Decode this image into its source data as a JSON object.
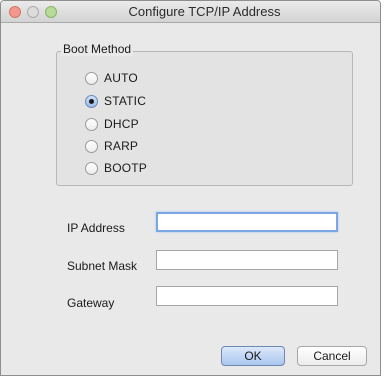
{
  "window": {
    "title": "Configure TCP/IP Address"
  },
  "boot_method": {
    "label": "Boot Method",
    "options": [
      {
        "label": "AUTO",
        "selected": false
      },
      {
        "label": "STATIC",
        "selected": true
      },
      {
        "label": "DHCP",
        "selected": false
      },
      {
        "label": "RARP",
        "selected": false
      },
      {
        "label": "BOOTP",
        "selected": false
      }
    ]
  },
  "fields": {
    "ip_address": {
      "label": "IP Address",
      "value": ""
    },
    "subnet_mask": {
      "label": "Subnet Mask",
      "value": ""
    },
    "gateway": {
      "label": "Gateway",
      "value": ""
    }
  },
  "buttons": {
    "ok": "OK",
    "cancel": "Cancel"
  },
  "colors": {
    "accent": "#7aa7e4",
    "default_button": "#a9c6ef"
  }
}
